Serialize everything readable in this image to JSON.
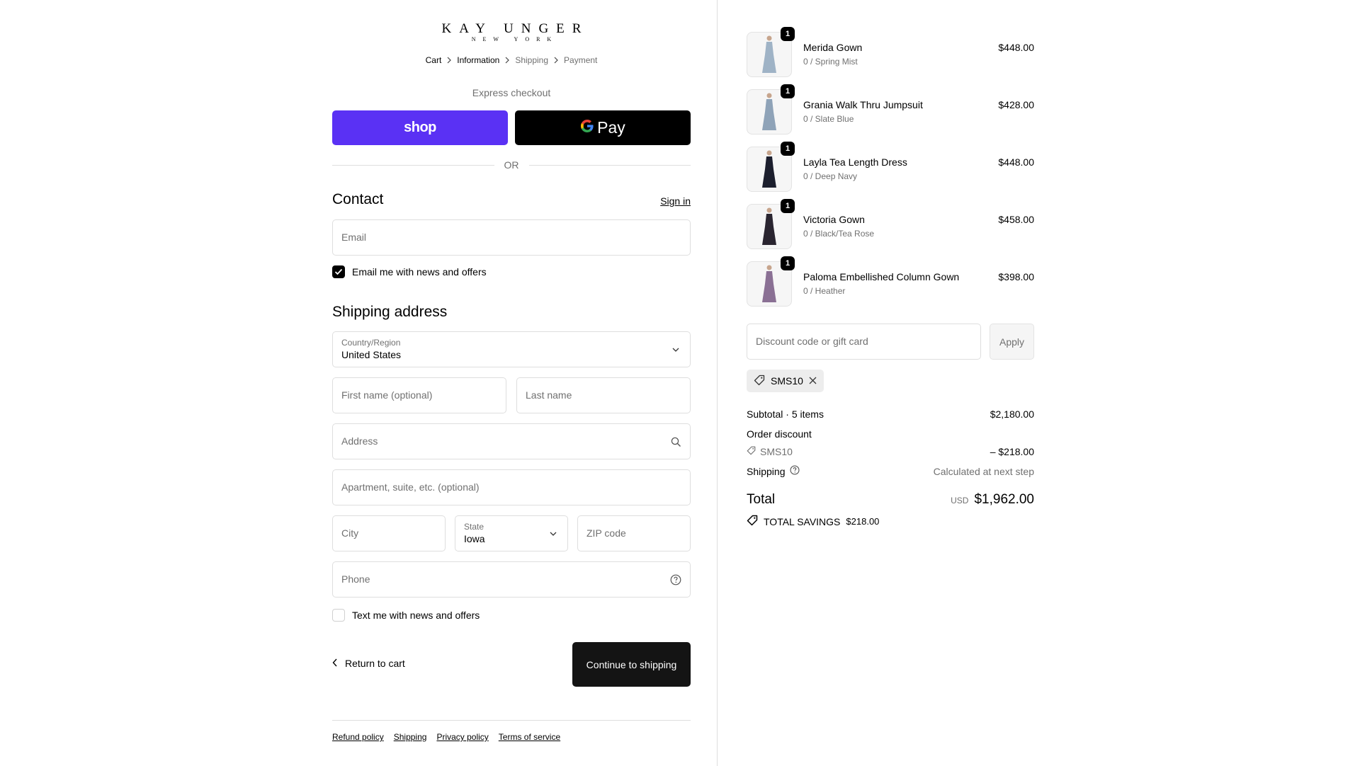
{
  "brand": {
    "name": "KAY UNGER",
    "sub": "NEW YORK"
  },
  "breadcrumb": [
    "Cart",
    "Information",
    "Shipping",
    "Payment"
  ],
  "express": {
    "label": "Express checkout",
    "shop_label": "shop",
    "gpay_label": "Pay"
  },
  "or_label": "OR",
  "contact": {
    "heading": "Contact",
    "sign_in": "Sign in",
    "email_placeholder": "Email",
    "email_opt_in": "Email me with news and offers",
    "email_opt_in_checked": true
  },
  "shipping": {
    "heading": "Shipping address",
    "country_label": "Country/Region",
    "country_value": "United States",
    "first_name_placeholder": "First name (optional)",
    "last_name_placeholder": "Last name",
    "address_placeholder": "Address",
    "apartment_placeholder": "Apartment, suite, etc. (optional)",
    "city_placeholder": "City",
    "state_label": "State",
    "state_value": "Iowa",
    "zip_placeholder": "ZIP code",
    "phone_placeholder": "Phone",
    "text_opt_in": "Text me with news and offers",
    "text_opt_in_checked": false
  },
  "actions": {
    "return_label": "Return to cart",
    "continue_label": "Continue to shipping"
  },
  "footer_links": [
    "Refund policy",
    "Shipping",
    "Privacy policy",
    "Terms of service"
  ],
  "cart": {
    "items": [
      {
        "name": "Merida Gown",
        "variant": "0 / Spring Mist",
        "price": "$448.00",
        "qty": "1",
        "color": "#9fb3c6"
      },
      {
        "name": "Grania Walk Thru Jumpsuit",
        "variant": "0 / Slate Blue",
        "price": "$428.00",
        "qty": "1",
        "color": "#8fa3b8"
      },
      {
        "name": "Layla Tea Length Dress",
        "variant": "0 / Deep Navy",
        "price": "$448.00",
        "qty": "1",
        "color": "#1c1f2e"
      },
      {
        "name": "Victoria Gown",
        "variant": "0 / Black/Tea Rose",
        "price": "$458.00",
        "qty": "1",
        "color": "#2a2530"
      },
      {
        "name": "Paloma Embellished Column Gown",
        "variant": "0 / Heather",
        "price": "$398.00",
        "qty": "1",
        "color": "#8a7094"
      }
    ],
    "discount_placeholder": "Discount code or gift card",
    "apply_label": "Apply",
    "applied_code": "SMS10"
  },
  "summary": {
    "subtotal_label": "Subtotal · 5 items",
    "subtotal_value": "$2,180.00",
    "order_discount_label": "Order discount",
    "discount_code": "SMS10",
    "discount_value": "– $218.00",
    "shipping_label": "Shipping",
    "shipping_value": "Calculated at next step",
    "total_label": "Total",
    "currency": "USD",
    "total_value": "$1,962.00",
    "savings_label": "TOTAL SAVINGS",
    "savings_value": "$218.00"
  }
}
